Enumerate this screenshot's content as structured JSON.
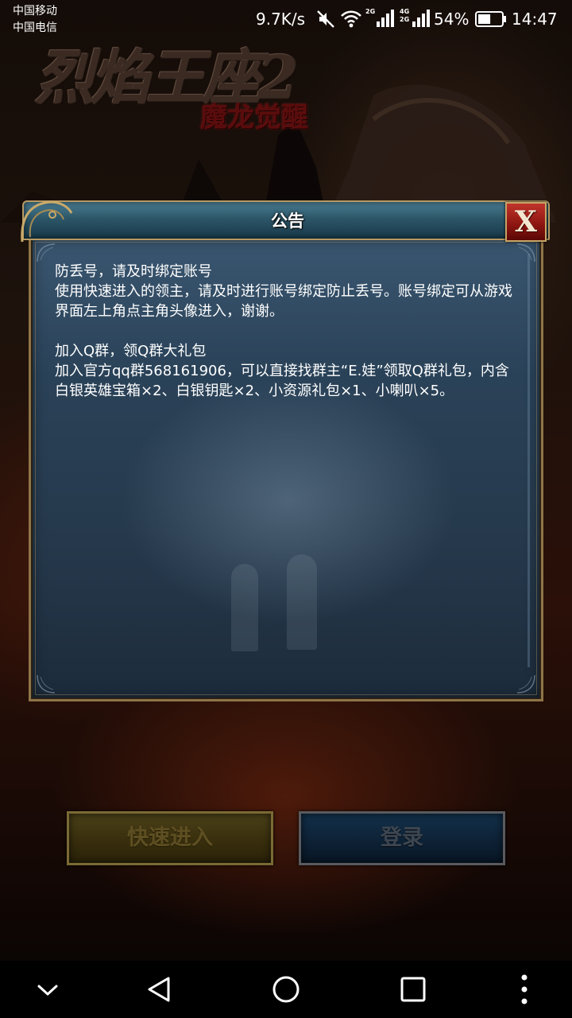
{
  "status_bar": {
    "carrier_1": "中国移动",
    "carrier_2": "中国电信",
    "net_speed": "9.7K/s",
    "network_tag_1": "2G",
    "network_tag_2a": "4G",
    "network_tag_2b": "2G",
    "battery_level": "54%",
    "battery_fraction": 0.54,
    "time": "14:47"
  },
  "game_logo": {
    "title": "烈焰王座2",
    "subtitle": "魔龙觉醒"
  },
  "dialog": {
    "title": "公告",
    "close_label": "X",
    "paragraphs": [
      {
        "heading": "防丢号，请及时绑定账号",
        "body": "使用快速进入的领主，请及时进行账号绑定防止丢号。账号绑定可从游戏界面左上角点主角头像进入，谢谢。"
      },
      {
        "heading": "加入Q群，领Q群大礼包",
        "body": "加入官方qq群568161906，可以直接找群主“E.娃”领取Q群礼包，内含白银英雄宝箱×2、白银钥匙×2、小资源礼包×1、小喇叭×5。"
      }
    ]
  },
  "game_buttons": {
    "quick_enter": "快速进入",
    "login": "登录"
  },
  "nav_bar": {
    "icons": [
      "chevron-down-icon",
      "back-icon",
      "home-icon",
      "recents-icon",
      "more-icon"
    ]
  },
  "colors": {
    "dialog_header": "#2c5668",
    "dialog_body": "#2a4258",
    "frame_gold": "#b79a63",
    "close_red": "#8a1410"
  }
}
